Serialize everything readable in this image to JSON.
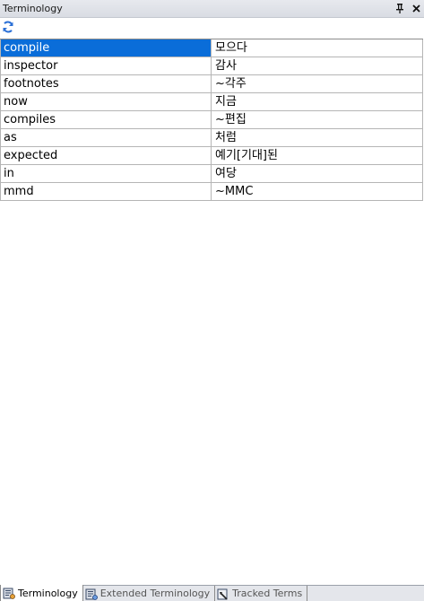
{
  "panel": {
    "title": "Terminology",
    "pin_icon": "pin-icon",
    "close_icon": "close-icon"
  },
  "toolbar": {
    "refresh_icon": "refresh-icon"
  },
  "table": {
    "selected_index": 0,
    "rows": [
      {
        "term": "compile",
        "translation": "모으다"
      },
      {
        "term": "inspector",
        "translation": "감사"
      },
      {
        "term": "footnotes",
        "translation": "~각주"
      },
      {
        "term": "now",
        "translation": "지금"
      },
      {
        "term": "compiles",
        "translation": "~편집"
      },
      {
        "term": "as",
        "translation": "처럼"
      },
      {
        "term": "expected",
        "translation": "예기[기대]된"
      },
      {
        "term": "in",
        "translation": "여당"
      },
      {
        "term": "mmd",
        "translation": "~MMC"
      }
    ]
  },
  "tabs": [
    {
      "label": "Terminology",
      "active": true,
      "icon": "terminology-icon"
    },
    {
      "label": "Extended Terminology",
      "active": false,
      "icon": "extended-terminology-icon"
    },
    {
      "label": "Tracked Terms",
      "active": false,
      "icon": "tracked-terms-icon"
    }
  ],
  "colors": {
    "selection": "#0a6dd9",
    "refresh_blue": "#2a6fd6"
  }
}
